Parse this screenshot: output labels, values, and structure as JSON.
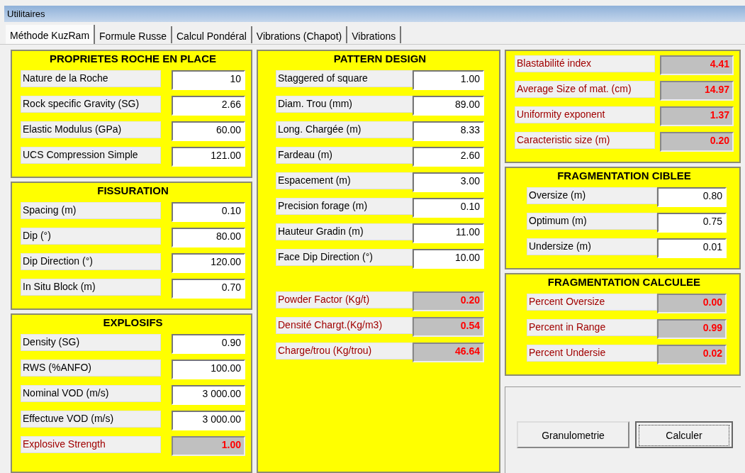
{
  "window": {
    "title": "Utilitaires"
  },
  "tabs": [
    {
      "label": "Méthode KuzRam",
      "selected": true
    },
    {
      "label": "Formule Russe",
      "selected": false
    },
    {
      "label": "Calcul Pondéral",
      "selected": false
    },
    {
      "label": "Vibrations (Chapot)",
      "selected": false
    },
    {
      "label": "Vibrations",
      "selected": false
    }
  ],
  "columns": [
    [
      {
        "kind": "fields",
        "title": "PROPRIETES ROCHE EN PLACE",
        "rows": [
          {
            "kind": "input",
            "label": "Nature de la Roche",
            "value": "10"
          },
          {
            "kind": "input",
            "label": "Rock specific Gravity (SG)",
            "value": "2.66"
          },
          {
            "kind": "input",
            "label": "Elastic Modulus (GPa)",
            "value": "60.00"
          },
          {
            "kind": "input",
            "label": "UCS Compression Simple",
            "value": "121.00"
          }
        ]
      },
      {
        "kind": "fields",
        "title": "FISSURATION",
        "rows": [
          {
            "kind": "input",
            "label": "Spacing (m)",
            "value": "0.10"
          },
          {
            "kind": "input",
            "label": "Dip (°)",
            "value": "80.00"
          },
          {
            "kind": "input",
            "label": "Dip Direction (°)",
            "value": "120.00"
          },
          {
            "kind": "input",
            "label": "In Situ Block (m)",
            "value": "0.70"
          }
        ]
      },
      {
        "kind": "fields",
        "title": "EXPLOSIFS",
        "rows": [
          {
            "kind": "input",
            "label": "Density (SG)",
            "value": "0.90"
          },
          {
            "kind": "input",
            "label": "RWS (%ANFO)",
            "value": "100.00"
          },
          {
            "kind": "input",
            "label": "Nominal VOD (m/s)",
            "value": "3 000.00"
          },
          {
            "kind": "input",
            "label": "Effectuve VOD (m/s)",
            "value": "3 000.00"
          },
          {
            "kind": "output",
            "label": "Explosive Strength",
            "value": "1.00"
          }
        ]
      }
    ],
    [
      {
        "kind": "fields",
        "title": "PATTERN DESIGN",
        "rows": [
          {
            "kind": "input",
            "label": "Staggered of square",
            "value": "1.00"
          },
          {
            "kind": "input",
            "label": "Diam. Trou (mm)",
            "value": "89.00"
          },
          {
            "kind": "input",
            "label": "Long. Chargée (m)",
            "value": "8.33"
          },
          {
            "kind": "input",
            "label": "Fardeau (m)",
            "value": "2.60"
          },
          {
            "kind": "input",
            "label": "Espacement (m)",
            "value": "3.00"
          },
          {
            "kind": "input",
            "label": "Precision forage (m)",
            "value": "0.10"
          },
          {
            "kind": "input",
            "label": "Hauteur Gradin (m)",
            "value": "11.00"
          },
          {
            "kind": "input",
            "label": "Face Dip Direction (°)",
            "value": "10.00"
          },
          {
            "kind": "output",
            "label": "Powder Factor (Kg/t)",
            "value": "0.20"
          },
          {
            "kind": "output",
            "label": "Densité Chargt.(Kg/m3)",
            "value": "0.54"
          },
          {
            "kind": "output",
            "label": "Charge/trou (Kg/trou)",
            "value": "46.64"
          }
        ]
      }
    ],
    [
      {
        "kind": "fields",
        "rows": [
          {
            "kind": "output",
            "label": "Blastabilité index",
            "value": "4.41"
          },
          {
            "kind": "output",
            "label": "Average Size of mat. (cm)",
            "value": "14.97"
          },
          {
            "kind": "output",
            "label": "Uniformity exponent",
            "value": "1.37"
          },
          {
            "kind": "output",
            "label": "Caracteristic size (m)",
            "value": "0.20"
          }
        ]
      },
      {
        "kind": "fields",
        "title": "FRAGMENTATION CIBLEE",
        "rows": [
          {
            "kind": "input",
            "label": "Oversize (m)",
            "value": "0.80"
          },
          {
            "kind": "input",
            "label": "Optimum (m)",
            "value": "0.75"
          },
          {
            "kind": "input",
            "label": "Undersize (m)",
            "value": "0.01"
          }
        ]
      },
      {
        "kind": "fields",
        "title": "FRAGMENTATION CALCULEE",
        "rows": [
          {
            "kind": "output",
            "label": "Percent Oversize",
            "value": "0.00"
          },
          {
            "kind": "output",
            "label": "Percent in Range",
            "value": "0.99"
          },
          {
            "kind": "output",
            "label": "Percent Undersie",
            "value": "0.02"
          }
        ]
      },
      {
        "kind": "buttons",
        "buttons": [
          {
            "label": "Granulometrie",
            "focused": false
          },
          {
            "label": "Calculer",
            "focused": true
          }
        ]
      }
    ]
  ]
}
